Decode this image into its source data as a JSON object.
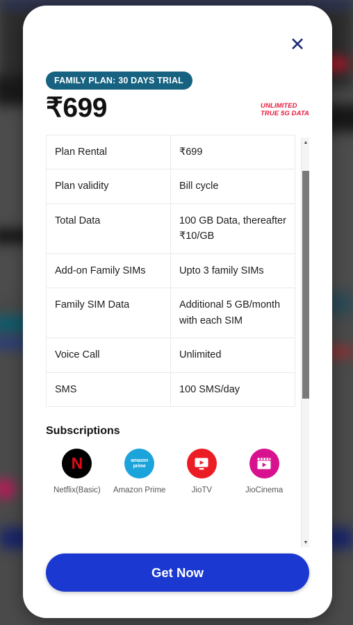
{
  "modal": {
    "close_label": "✕",
    "badge": "FAMILY PLAN: 30 DAYS TRIAL",
    "price": "₹699",
    "tagline": "UNLIMITED\nTRUE 5G DATA",
    "accent_badge_color": "#166280",
    "accent_tagline_color": "#e8193c",
    "cta_color": "#1b39d0"
  },
  "plan_table": {
    "rows": [
      {
        "label": "Plan Rental",
        "value": "₹699"
      },
      {
        "label": "Plan validity",
        "value": "Bill cycle"
      },
      {
        "label": "Total Data",
        "value": "100 GB Data, thereafter ₹10/GB"
      },
      {
        "label": "Add-on Family SIMs",
        "value": "Upto 3 family SIMs"
      },
      {
        "label": "Family SIM Data",
        "value": "Additional 5 GB/month with each SIM"
      },
      {
        "label": "Voice Call",
        "value": "Unlimited"
      },
      {
        "label": "SMS",
        "value": "100 SMS/day"
      }
    ]
  },
  "subscriptions": {
    "title": "Subscriptions",
    "items": [
      {
        "label": "Netflix(Basic)",
        "icon": "netflix-icon",
        "glyph": "N",
        "color": "#000000"
      },
      {
        "label": "Amazon Prime",
        "icon": "amazon-prime-icon",
        "glyph": "amazon prime",
        "color": "#1ba3db"
      },
      {
        "label": "JioTV",
        "icon": "jiotv-icon",
        "glyph": "tv-play",
        "color": "#ec1c24"
      },
      {
        "label": "JioCinema",
        "icon": "jiocinema-icon",
        "glyph": "clapper-play",
        "color": "#d8128f"
      }
    ]
  },
  "scrollbar": {
    "up_arrow": "▲",
    "down_arrow": "▼"
  },
  "cta": {
    "label": "Get Now"
  }
}
